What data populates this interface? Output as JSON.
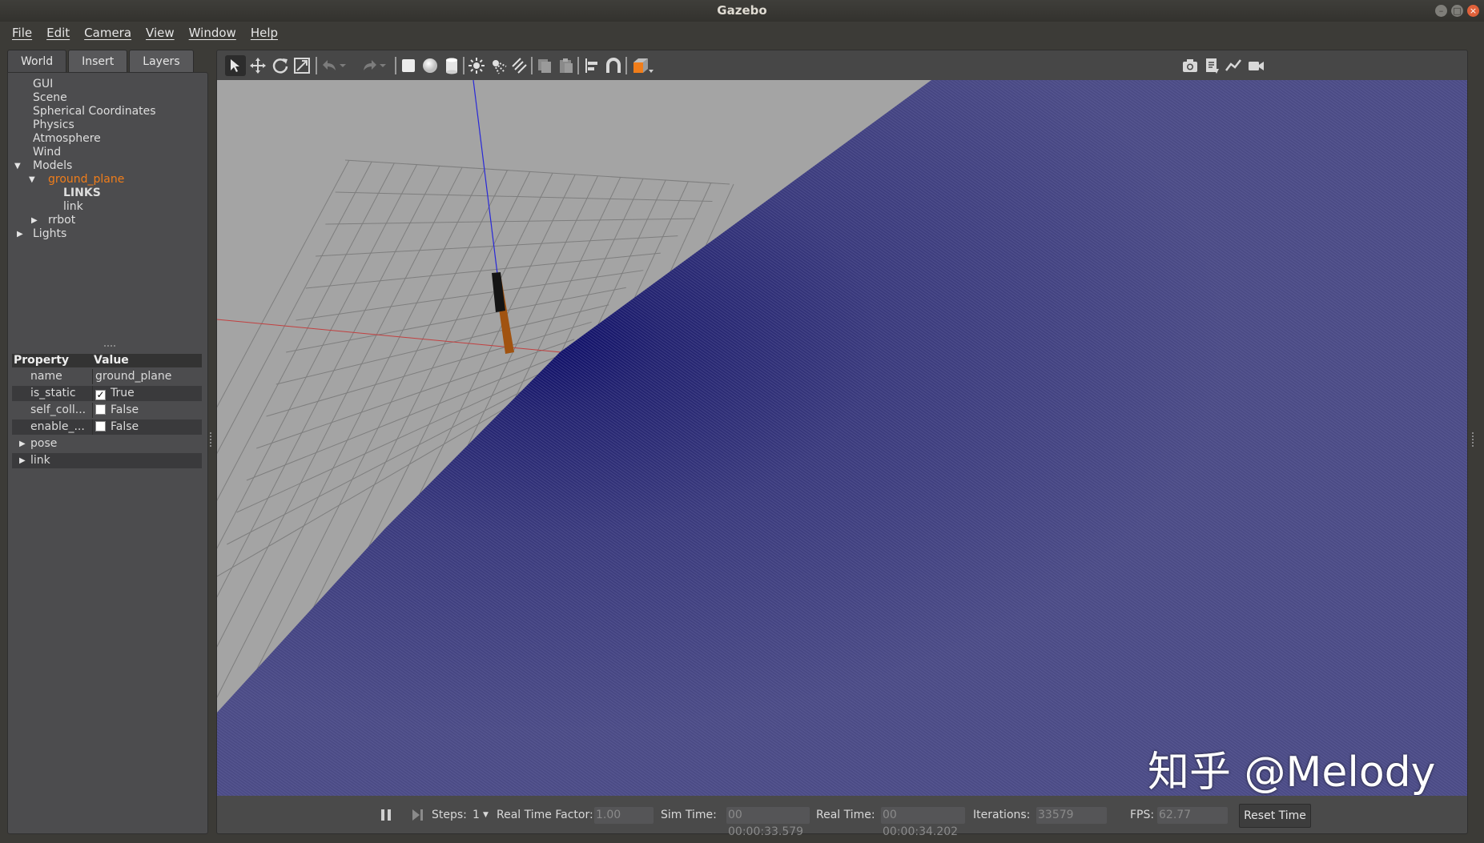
{
  "window": {
    "title": "Gazebo"
  },
  "menu": [
    "File",
    "Edit",
    "Camera",
    "View",
    "Window",
    "Help"
  ],
  "tabs": [
    {
      "label": "World",
      "active": true
    },
    {
      "label": "Insert",
      "active": false
    },
    {
      "label": "Layers",
      "active": false
    }
  ],
  "tree": {
    "gui": "GUI",
    "scene": "Scene",
    "spherical": "Spherical Coordinates",
    "physics": "Physics",
    "atmosphere": "Atmosphere",
    "wind": "Wind",
    "models": "Models",
    "ground_plane": "ground_plane",
    "links_header": "LINKS",
    "link": "link",
    "rrbot": "rrbot",
    "lights": "Lights"
  },
  "properties": {
    "header_property": "Property",
    "header_value": "Value",
    "rows": [
      {
        "name": "name",
        "value": "ground_plane"
      },
      {
        "name": "is_static",
        "value": "True",
        "checked": true
      },
      {
        "name": "self_coll...",
        "value": "False",
        "checked": false
      },
      {
        "name": "enable_...",
        "value": "False",
        "checked": false
      }
    ],
    "sections": [
      "pose",
      "link"
    ]
  },
  "toolbar": {
    "icons": [
      "select-mode-icon",
      "translate-mode-icon",
      "rotate-mode-icon",
      "scale-mode-icon",
      "undo-icon",
      "undo-history-icon",
      "redo-icon",
      "redo-history-icon",
      "box-shape-icon",
      "sphere-shape-icon",
      "cylinder-shape-icon",
      "point-light-icon",
      "spot-light-icon",
      "directional-light-icon",
      "copy-icon",
      "paste-icon",
      "align-icon",
      "snap-icon",
      "view-angle-icon",
      "screenshot-icon",
      "log-icon",
      "plot-icon",
      "record-video-icon"
    ]
  },
  "status": {
    "steps_label": "Steps:",
    "steps_value": "1",
    "rtf_label": "Real Time Factor:",
    "rtf_value": "1.00",
    "sim_time_label": "Sim Time:",
    "sim_time_value": "00 00:00:33.579",
    "real_time_label": "Real Time:",
    "real_time_value": "00 00:00:34.202",
    "iterations_label": "Iterations:",
    "iterations_value": "33579",
    "fps_label": "FPS:",
    "fps_value": "62.77",
    "reset_label": "Reset Time"
  },
  "watermark": "知乎 @Melody",
  "colors": {
    "selected": "#f07d1a",
    "ground": "#35357a",
    "viewport_bg": "#a3a3a3"
  }
}
